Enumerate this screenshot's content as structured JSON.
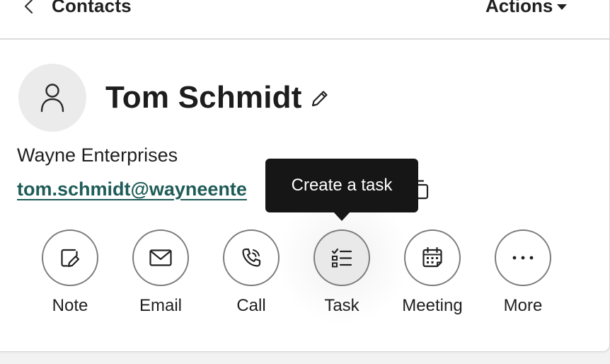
{
  "header": {
    "title": "Contacts",
    "actions_label": "Actions"
  },
  "contact": {
    "name": "Tom Schmidt",
    "company": "Wayne Enterprises",
    "email": "tom.schmidt@wayneente"
  },
  "tooltip": {
    "text": "Create a task"
  },
  "quick_actions": [
    {
      "label": "Note",
      "icon": "note-edit-icon"
    },
    {
      "label": "Email",
      "icon": "envelope-icon"
    },
    {
      "label": "Call",
      "icon": "phone-icon"
    },
    {
      "label": "Task",
      "icon": "task-list-icon",
      "active": true
    },
    {
      "label": "Meeting",
      "icon": "calendar-icon"
    },
    {
      "label": "More",
      "icon": "ellipsis-icon"
    }
  ],
  "colors": {
    "email_link": "#1f5c58",
    "tooltip_bg": "#161616",
    "border": "#7c7c7c"
  }
}
